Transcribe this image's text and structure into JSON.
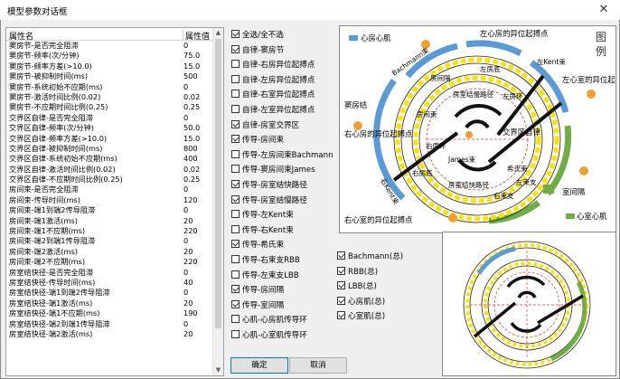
{
  "window": {
    "title": "模型参数对话框",
    "close": "✕"
  },
  "table": {
    "col_name": "属性名",
    "col_value": "属性值",
    "rows": [
      {
        "name": "窦房节-是否完全阻滞",
        "value": "0"
      },
      {
        "name": "窦房节-频率(次/分钟)",
        "value": "75.0"
      },
      {
        "name": "窦房节-频率方差(>10.0)",
        "value": "15.0"
      },
      {
        "name": "窦房节-被抑制时间(ms)",
        "value": "500"
      },
      {
        "name": "窦房节-系统初始不应期(ms)",
        "value": "0"
      },
      {
        "name": "窦房节-激活时间比例(0.02)",
        "value": "0.02"
      },
      {
        "name": "窦房节-不应期时间比例(0.25)",
        "value": "0.25"
      },
      {
        "name": "交界区自律-是否完全阻滞",
        "value": "0"
      },
      {
        "name": "交界区自律-频率(次/分钟)",
        "value": "50.0"
      },
      {
        "name": "交界区自律-频率方差(>10.0)",
        "value": "15.0"
      },
      {
        "name": "交界区自律-被抑制时间(ms)",
        "value": "800"
      },
      {
        "name": "交界区自律-系统初始不应期(ms)",
        "value": "400"
      },
      {
        "name": "交界区自律-激活时间比例(0.02)",
        "value": "0.02"
      },
      {
        "name": "交界区自律-不应期时间比例(0.25)",
        "value": "0.25"
      },
      {
        "name": "房间束-是否完全阻滞",
        "value": "0"
      },
      {
        "name": "房间束-传导时间(ms)",
        "value": "120"
      },
      {
        "name": "房间束-端1到端2传导阻滞",
        "value": "0"
      },
      {
        "name": "房间束-端1激活(ms)",
        "value": "20"
      },
      {
        "name": "房间束-端1不应期(ms)",
        "value": "220"
      },
      {
        "name": "房间束-端2到端1传导阻滞",
        "value": "0"
      },
      {
        "name": "房间束-端2激活(ms)",
        "value": "20"
      },
      {
        "name": "房间束-端2不应期(ms)",
        "value": "220"
      },
      {
        "name": "房室结快径-是否完全阻滞",
        "value": "0"
      },
      {
        "name": "房室结快径-传导时间(ms)",
        "value": "40"
      },
      {
        "name": "房室结快径-端1到端2传导阻滞",
        "value": "0"
      },
      {
        "name": "房室结快径-端1激活(ms)",
        "value": "20"
      },
      {
        "name": "房室结快径-端1不应期(ms)",
        "value": "190"
      },
      {
        "name": "房室结快径-端2到端1传导阻滞",
        "value": "0"
      },
      {
        "name": "房室结快径-端2激活(ms)",
        "value": "20"
      }
    ]
  },
  "checkboxes": [
    {
      "label": "全选/全不选",
      "checked": true
    },
    {
      "label": "自律-窦房节",
      "checked": true
    },
    {
      "label": "自律-右房异位起搏点",
      "checked": false
    },
    {
      "label": "自律-左房异位起搏点",
      "checked": false
    },
    {
      "label": "自律-右室异位起搏点",
      "checked": false
    },
    {
      "label": "自律-左室异位起搏点",
      "checked": false
    },
    {
      "label": "自律-房室交界区",
      "checked": true
    },
    {
      "label": "传导-房间束",
      "checked": true
    },
    {
      "label": "传导-左房间束Bachmann",
      "checked": false
    },
    {
      "label": "传导-窦房间束James",
      "checked": false
    },
    {
      "label": "传导-房室结快路径",
      "checked": true
    },
    {
      "label": "传导-房室结慢路径",
      "checked": true
    },
    {
      "label": "传导-左Kent束",
      "checked": false
    },
    {
      "label": "传导-右Kent束",
      "checked": false
    },
    {
      "label": "传导-希氏束",
      "checked": true
    },
    {
      "label": "传导-右束支RBB",
      "checked": false
    },
    {
      "label": "传导-左束支LBB",
      "checked": false
    },
    {
      "label": "传导-房间隔",
      "checked": true
    },
    {
      "label": "传导-室间隔",
      "checked": true
    },
    {
      "label": "心肌-心房肌传导环",
      "checked": false
    },
    {
      "label": "心肌-心室肌传导环",
      "checked": false
    }
  ],
  "checkboxes_right": [
    {
      "label": "Bachmann(总)",
      "checked": true
    },
    {
      "label": "RBB(总)",
      "checked": true
    },
    {
      "label": "LBB(总)",
      "checked": true
    },
    {
      "label": "心房肌(总)",
      "checked": true
    },
    {
      "label": "心室肌(总)",
      "checked": true
    }
  ],
  "legend": {
    "corner": "图\n例",
    "atrial_muscle": "心房心肌",
    "ventricular_muscle": "心室心肌",
    "left_atrial_ectopic": "左心房的异位起搏点",
    "left_ventricular_ectopic": "左心室的异位起搏点",
    "sinus_node": "窦房结",
    "right_atrial_ectopic": "右心房的异位起搏点",
    "right_ventricular_ectopic": "右心室的异位起搏点",
    "junction": "交界区自律",
    "septum": "室间隔",
    "bachmann": "Bachmann束",
    "inter_atrial": "房间隔",
    "slow_path": "房室结慢路径",
    "fast_path": "房室结快路径",
    "james": "James束",
    "left_kent": "左Kent束",
    "right_kent": "右Kent束",
    "atrial_ring_1": "左房底",
    "atrial_ring_2": "左房环",
    "atrial_ring_3": "右房底",
    "atrial_ring_4": "右房环",
    "atrial_ring_5": "房间束",
    "atrial_ring_6": "房间隔",
    "atrial_ring_7": "希氏束",
    "atrial_ring_8": "左束支",
    "atrial_ring_9": "右束支"
  },
  "buttons": {
    "ok": "确定",
    "cancel": "取消"
  },
  "colors": {
    "blue": "#5b9bd5",
    "yellow": "#ffe100",
    "green": "#70ad47",
    "orange": "#f0a030",
    "red": "#e03030"
  }
}
